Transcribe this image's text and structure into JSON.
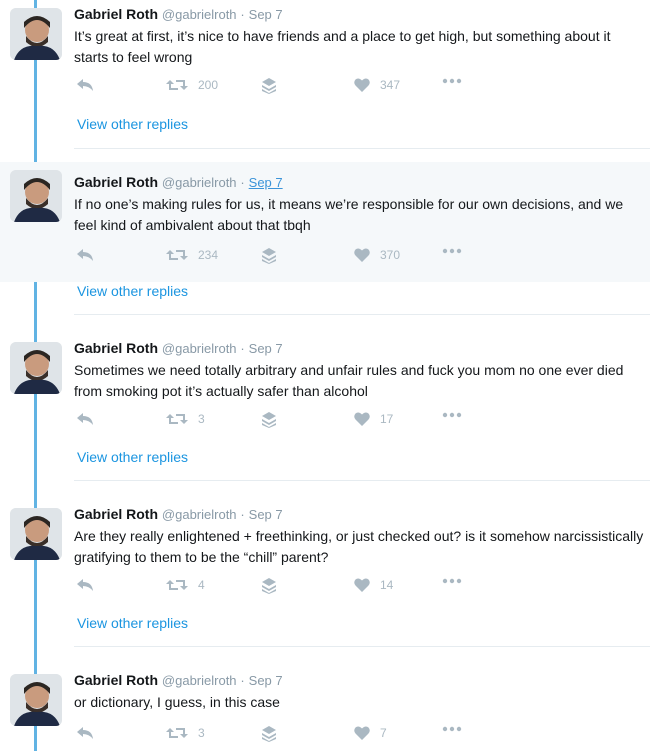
{
  "author": {
    "name": "Gabriel Roth",
    "handle": "@gabrielroth"
  },
  "separator": "·",
  "view_replies_label": "View other replies",
  "icons": {
    "reply": "reply-icon",
    "retweet": "retweet-icon",
    "stack": "stack-icon",
    "like": "heart-icon",
    "more": "more-icon"
  },
  "colors": {
    "thread_line": "#61b3e3",
    "link": "#1b95e0",
    "icon": "#aab8c2",
    "highlight_bg": "#f5f8fa"
  },
  "tweets": [
    {
      "date": "Sep 7",
      "text": "It’s great at first, it’s nice to have friends and a place to get high, but something about it starts to feel wrong",
      "retweets": "200",
      "likes": "347"
    },
    {
      "date": "Sep 7",
      "text": "If no one’s making rules for us, it means we’re responsible for our own decisions, and we feel kind of ambivalent about that tbqh",
      "retweets": "234",
      "likes": "370"
    },
    {
      "date": "Sep 7",
      "text": "Sometimes we need totally arbitrary and unfair rules and fuck you mom no one ever died from smoking pot it’s actually safer than alcohol",
      "retweets": "3",
      "likes": "17"
    },
    {
      "date": "Sep 7",
      "text": "Are they really enlightened + freethinking, or just checked out? is it somehow narcissistically gratifying to them to be the “chill” parent?",
      "retweets": "4",
      "likes": "14"
    },
    {
      "date": "Sep 7",
      "text": "or dictionary, I guess, in this case",
      "retweets": "3",
      "likes": "7"
    }
  ]
}
